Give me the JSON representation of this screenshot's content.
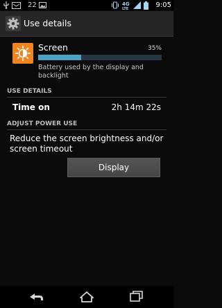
{
  "status_bar": {
    "notification_count": "22",
    "network_type": "4G LTE",
    "time": "9:05",
    "icons": [
      "usb-icon",
      "notification-count-icon",
      "image-icon",
      "vibrate-icon",
      "network-icon",
      "signal-icon",
      "battery-icon"
    ]
  },
  "action_bar": {
    "title": "Use details",
    "icon": "settings-icon"
  },
  "entry": {
    "name": "Screen",
    "percent_label": "35%",
    "percent_value": 0.35,
    "description": "Battery used by the display and backlight",
    "icon": "brightness-icon"
  },
  "use_details": {
    "header": "USE DETAILS",
    "rows": [
      {
        "label": "Time on",
        "value": "2h 14m 22s"
      }
    ]
  },
  "adjust_power": {
    "header": "ADJUST POWER USE",
    "suggestion": "Reduce the screen brightness and/or screen timeout",
    "button_label": "Display"
  },
  "nav_bar": {
    "icons": [
      "back-icon",
      "home-icon",
      "recent-apps-icon"
    ]
  },
  "colors": {
    "accent": "#4aa3c2",
    "background": "#0b0b0b",
    "action_bar": "#262626",
    "icon_orange": "#f0841f"
  }
}
